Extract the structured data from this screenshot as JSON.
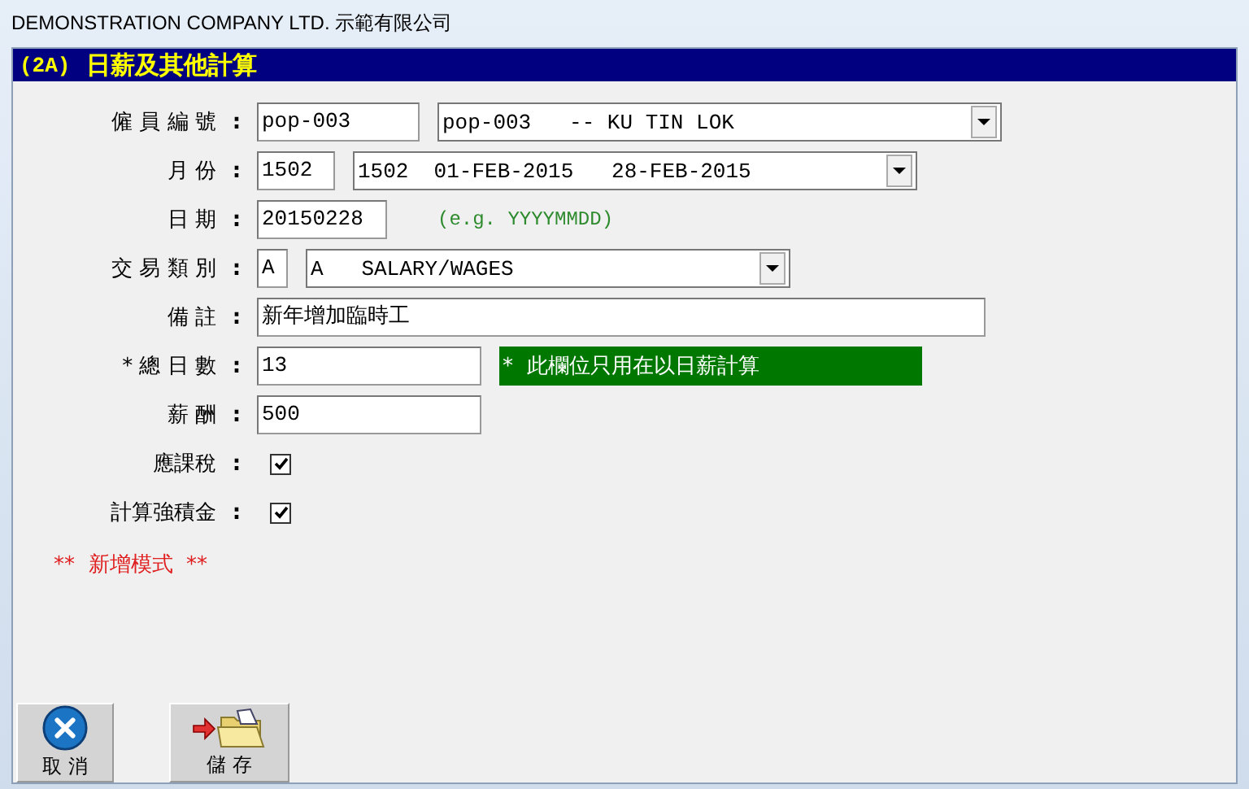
{
  "window": {
    "title": "DEMONSTRATION COMPANY LTD. 示範有限公司"
  },
  "form": {
    "code": "(2A)",
    "title": "日薪及其他計算"
  },
  "fields": [
    {
      "kind": "combo",
      "label": "僱 員 編 號",
      "colon": ":",
      "value": "pop-003",
      "combo": "pop-003   -- KU TIN LOK"
    },
    {
      "kind": "combo",
      "label": "月 份",
      "colon": ":",
      "value": "1502",
      "combo": "1502  01-FEB-2015   28-FEB-2015"
    },
    {
      "kind": "hint",
      "label": "日 期",
      "colon": ":",
      "value": "20150228",
      "hint": "(e.g. YYYYMMDD)"
    },
    {
      "kind": "combo",
      "label": "交 易 類 別",
      "colon": ":",
      "value": "A",
      "combo": "A   SALARY/WAGES"
    },
    {
      "kind": "text",
      "label": "備 註",
      "colon": ":",
      "value": "新年增加臨時工"
    },
    {
      "kind": "note",
      "label": "* 總 日 數",
      "colon": ":",
      "value": "13",
      "note": "*  此欄位只用在以日薪計算"
    },
    {
      "kind": "text",
      "label": "薪 酬",
      "colon": ":",
      "value": "500"
    },
    {
      "kind": "checkbox",
      "label": "應課稅",
      "colon": ":",
      "checked": true
    },
    {
      "kind": "checkbox",
      "label": "計算強積金",
      "colon": ":",
      "checked": true
    }
  ],
  "mode": "**  新增模式  **",
  "buttons": [
    {
      "kind": "cancel",
      "label": "取 消"
    },
    {
      "kind": "save",
      "label": "儲 存"
    }
  ]
}
